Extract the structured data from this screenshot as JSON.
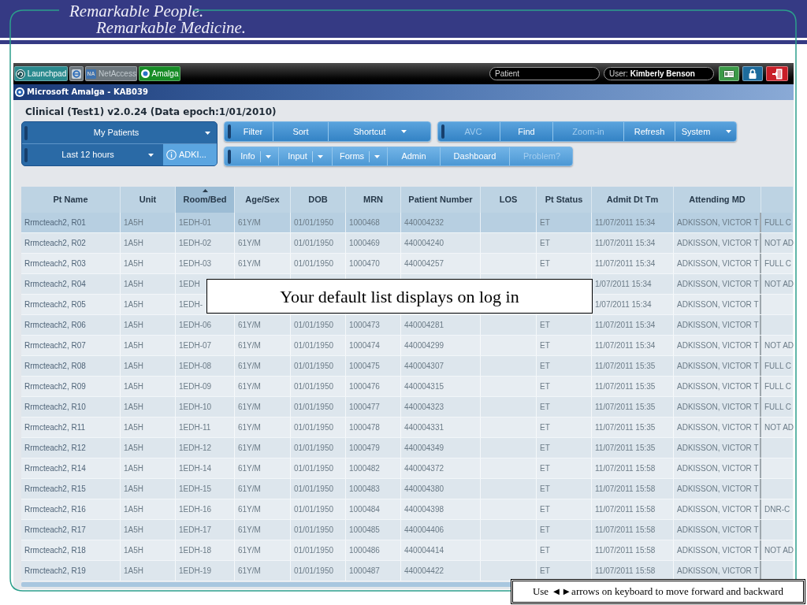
{
  "banner": {
    "lines": [
      "Remarkable People.",
      "Remarkable Medicine."
    ]
  },
  "taskbar": {
    "apps": [
      {
        "kind": "labeled",
        "label": "Launchpad",
        "color": "#2a8a8e",
        "disabled": false
      },
      {
        "kind": "icon",
        "color": "#6d777d",
        "disabled": false
      },
      {
        "kind": "labeled",
        "label": "NetAccess",
        "badge": "NA",
        "color": "#6d777d",
        "disabled": true
      },
      {
        "kind": "labeled",
        "label": "Amalga",
        "color": "#178c26",
        "disabled": false
      }
    ],
    "patient_field": {
      "placeholder": "Patient"
    },
    "user": "User: **Kimberly Benson**",
    "quick_buttons": [
      {
        "color": "#3c9a48"
      },
      {
        "color": "#1d6b9c"
      },
      {
        "color": "#c91f28"
      }
    ]
  },
  "window": {
    "title": "Microsoft Amalga - KAB039"
  },
  "heading": "Clinical (Test1) v2.0.24 (Data epoch:1/01/2010)",
  "list_panel": {
    "list": "My Patients",
    "period": "Last 12 hours",
    "attending": "ADKI..."
  },
  "toolbars": [
    {
      "buttons": [
        {
          "label": "Filter",
          "kind": "button",
          "disabled": false
        },
        {
          "label": "Sort",
          "kind": "button",
          "disabled": false
        },
        {
          "label": "Shortcut",
          "kind": "menu",
          "disabled": false
        }
      ]
    },
    {
      "buttons": [
        {
          "label": "AVC",
          "kind": "button",
          "disabled": true
        },
        {
          "label": "Find",
          "kind": "button",
          "disabled": false
        },
        {
          "label": "Zoom-in",
          "kind": "button",
          "disabled": true
        },
        {
          "label": "Refresh",
          "kind": "button",
          "disabled": false
        },
        {
          "label": "System",
          "kind": "menu",
          "disabled": false
        }
      ]
    },
    {
      "buttons": [
        {
          "label": "Info",
          "kind": "split",
          "disabled": false
        },
        {
          "label": "Input",
          "kind": "split",
          "disabled": false
        },
        {
          "label": "Forms",
          "kind": "split",
          "disabled": false
        },
        {
          "label": "Admin",
          "kind": "button",
          "disabled": false
        },
        {
          "label": "Dashboard",
          "kind": "button",
          "disabled": false
        },
        {
          "label": "Problem?",
          "kind": "button",
          "disabled": true
        }
      ]
    }
  ],
  "table": {
    "columns": [
      {
        "label": "Pt Name",
        "sorted": false
      },
      {
        "label": "Unit",
        "sorted": false
      },
      {
        "label": "Room/Bed",
        "sorted": true
      },
      {
        "label": "Age/Sex",
        "sorted": false
      },
      {
        "label": "DOB",
        "sorted": false
      },
      {
        "label": "MRN",
        "sorted": false
      },
      {
        "label": "Patient Number",
        "sorted": false
      },
      {
        "label": "LOS",
        "sorted": false
      },
      {
        "label": "Pt Status",
        "sorted": false
      },
      {
        "label": "Admit Dt Tm",
        "sorted": false
      },
      {
        "label": "Attending MD",
        "sorted": false
      },
      {
        "sorted": false
      }
    ],
    "rows": [
      {
        "selected": true,
        "pt_name": "Rrmcteach2, R01",
        "unit": "1A5H",
        "room_bed": "1EDH-01",
        "age_sex": "61Y/M",
        "dob": "01/01/1950",
        "mrn": "1000468",
        "patient_number": "440004232",
        "pt_status": "ET",
        "admit_dt_tm": "11/07/2011 15:34",
        "attending_md": "ADKISSON, VICTOR T",
        "column_12": "FULL C"
      },
      {
        "selected": false,
        "pt_name": "Rrmcteach2, R02",
        "unit": "1A5H",
        "room_bed": "1EDH-02",
        "age_sex": "61Y/M",
        "dob": "01/01/1950",
        "mrn": "1000469",
        "patient_number": "440004240",
        "pt_status": "ET",
        "admit_dt_tm": "11/07/2011 15:34",
        "attending_md": "ADKISSON, VICTOR T",
        "column_12": "NOT AD"
      },
      {
        "selected": false,
        "pt_name": "Rrmcteach2, R03",
        "unit": "1A5H",
        "room_bed": "1EDH-03",
        "age_sex": "61Y/M",
        "dob": "01/01/1950",
        "mrn": "1000470",
        "patient_number": "440004257",
        "pt_status": "ET",
        "admit_dt_tm": "11/07/2011 15:34",
        "attending_md": "ADKISSON, VICTOR T",
        "column_12": "FULL C"
      },
      {
        "selected": false,
        "pt_name": "Rrmcteach2, R04",
        "unit": "1A5H",
        "room_bed": "1EDH",
        "admit_dt_tm": "1/07/2011 15:34",
        "attending_md": "ADKISSON, VICTOR T",
        "column_12": "NOT AD"
      },
      {
        "selected": false,
        "pt_name": "Rrmcteach2, R05",
        "unit": "1A5H",
        "room_bed": "1EDH-",
        "admit_dt_tm": "1/07/2011 15:34",
        "attending_md": "ADKISSON, VICTOR T"
      },
      {
        "selected": false,
        "pt_name": "Rrmcteach2, R06",
        "unit": "1A5H",
        "room_bed": "1EDH-06",
        "age_sex": "61Y/M",
        "dob": "01/01/1950",
        "mrn": "1000473",
        "patient_number": "440004281",
        "pt_status": "ET",
        "admit_dt_tm": "11/07/2011 15:34",
        "attending_md": "ADKISSON, VICTOR T"
      },
      {
        "selected": false,
        "pt_name": "Rrmcteach2, R07",
        "unit": "1A5H",
        "room_bed": "1EDH-07",
        "age_sex": "61Y/M",
        "dob": "01/01/1950",
        "mrn": "1000474",
        "patient_number": "440004299",
        "pt_status": "ET",
        "admit_dt_tm": "11/07/2011 15:34",
        "attending_md": "ADKISSON, VICTOR T",
        "column_12": "NOT AD"
      },
      {
        "selected": false,
        "pt_name": "Rrmcteach2, R08",
        "unit": "1A5H",
        "room_bed": "1EDH-08",
        "age_sex": "61Y/M",
        "dob": "01/01/1950",
        "mrn": "1000475",
        "patient_number": "440004307",
        "pt_status": "ET",
        "admit_dt_tm": "11/07/2011 15:35",
        "attending_md": "ADKISSON, VICTOR T",
        "column_12": "FULL C"
      },
      {
        "selected": false,
        "pt_name": "Rrmcteach2, R09",
        "unit": "1A5H",
        "room_bed": "1EDH-09",
        "age_sex": "61Y/M",
        "dob": "01/01/1950",
        "mrn": "1000476",
        "patient_number": "440004315",
        "pt_status": "ET",
        "admit_dt_tm": "11/07/2011 15:35",
        "attending_md": "ADKISSON, VICTOR T",
        "column_12": "FULL C"
      },
      {
        "selected": false,
        "pt_name": "Rrmcteach2, R10",
        "unit": "1A5H",
        "room_bed": "1EDH-10",
        "age_sex": "61Y/M",
        "dob": "01/01/1950",
        "mrn": "1000477",
        "patient_number": "440004323",
        "pt_status": "ET",
        "admit_dt_tm": "11/07/2011 15:35",
        "attending_md": "ADKISSON, VICTOR T",
        "column_12": "FULL C"
      },
      {
        "selected": false,
        "pt_name": "Rrmcteach2, R11",
        "unit": "1A5H",
        "room_bed": "1EDH-11",
        "age_sex": "61Y/M",
        "dob": "01/01/1950",
        "mrn": "1000478",
        "patient_number": "440004331",
        "pt_status": "ET",
        "admit_dt_tm": "11/07/2011 15:35",
        "attending_md": "ADKISSON, VICTOR T",
        "column_12": "NOT AD"
      },
      {
        "selected": false,
        "pt_name": "Rrmcteach2, R12",
        "unit": "1A5H",
        "room_bed": "1EDH-12",
        "age_sex": "61Y/M",
        "dob": "01/01/1950",
        "mrn": "1000479",
        "patient_number": "440004349",
        "pt_status": "ET",
        "admit_dt_tm": "11/07/2011 15:35",
        "attending_md": "ADKISSON, VICTOR T"
      },
      {
        "selected": false,
        "pt_name": "Rrmcteach2, R14",
        "unit": "1A5H",
        "room_bed": "1EDH-14",
        "age_sex": "61Y/M",
        "dob": "01/01/1950",
        "mrn": "1000482",
        "patient_number": "440004372",
        "pt_status": "ET",
        "admit_dt_tm": "11/07/2011 15:58",
        "attending_md": "ADKISSON, VICTOR T"
      },
      {
        "selected": false,
        "pt_name": "Rrmcteach2, R15",
        "unit": "1A5H",
        "room_bed": "1EDH-15",
        "age_sex": "61Y/M",
        "dob": "01/01/1950",
        "mrn": "1000483",
        "patient_number": "440004380",
        "pt_status": "ET",
        "admit_dt_tm": "11/07/2011 15:58",
        "attending_md": "ADKISSON, VICTOR T"
      },
      {
        "selected": false,
        "pt_name": "Rrmcteach2, R16",
        "unit": "1A5H",
        "room_bed": "1EDH-16",
        "age_sex": "61Y/M",
        "dob": "01/01/1950",
        "mrn": "1000484",
        "patient_number": "440004398",
        "pt_status": "ET",
        "admit_dt_tm": "11/07/2011 15:58",
        "attending_md": "ADKISSON, VICTOR T",
        "column_12": "DNR-C"
      },
      {
        "selected": false,
        "pt_name": "Rrmcteach2, R17",
        "unit": "1A5H",
        "room_bed": "1EDH-17",
        "age_sex": "61Y/M",
        "dob": "01/01/1950",
        "mrn": "1000485",
        "patient_number": "440004406",
        "pt_status": "ET",
        "admit_dt_tm": "11/07/2011 15:58",
        "attending_md": "ADKISSON, VICTOR T"
      },
      {
        "selected": false,
        "pt_name": "Rrmcteach2, R18",
        "unit": "1A5H",
        "room_bed": "1EDH-18",
        "age_sex": "61Y/M",
        "dob": "01/01/1950",
        "mrn": "1000486",
        "patient_number": "440004414",
        "pt_status": "ET",
        "admit_dt_tm": "11/07/2011 15:58",
        "attending_md": "ADKISSON, VICTOR T",
        "column_12": "NOT AD"
      },
      {
        "selected": false,
        "pt_name": "Rrmcteach2, R19",
        "unit": "1A5H",
        "room_bed": "1EDH-19",
        "age_sex": "61Y/M",
        "dob": "01/01/1950",
        "mrn": "1000487",
        "patient_number": "440004422",
        "pt_status": "ET",
        "admit_dt_tm": "11/07/2011 15:58",
        "attending_md": "ADKISSON, VICTOR T"
      }
    ]
  },
  "callout": "Your default list displays on log in",
  "navigation_hint": "Use ◄►arrows on keyboard to move forward and backward"
}
